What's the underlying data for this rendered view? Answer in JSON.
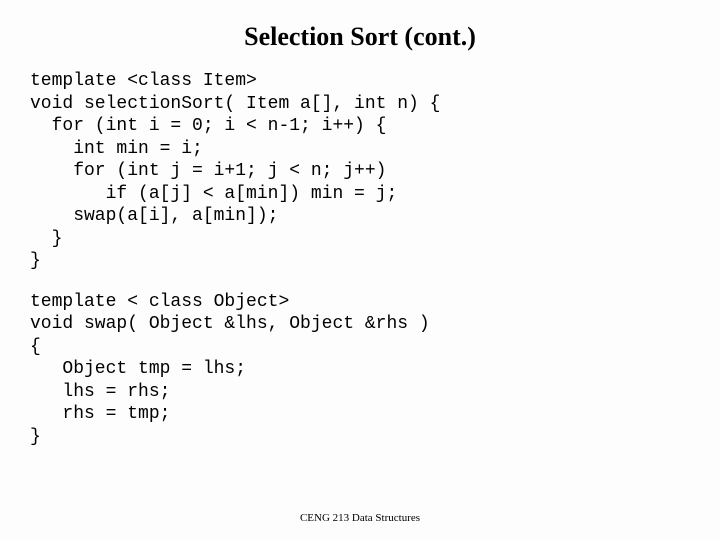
{
  "title": "Selection Sort (cont.)",
  "code_block_1": "template <class Item>\nvoid selectionSort( Item a[], int n) {\n  for (int i = 0; i < n-1; i++) {\n    int min = i;\n    for (int j = i+1; j < n; j++)\n       if (a[j] < a[min]) min = j;\n    swap(a[i], a[min]);\n  }\n}",
  "code_block_2": "template < class Object>\nvoid swap( Object &lhs, Object &rhs )\n{\n   Object tmp = lhs;\n   lhs = rhs;\n   rhs = tmp;\n}",
  "footer": "CENG 213 Data Structures"
}
